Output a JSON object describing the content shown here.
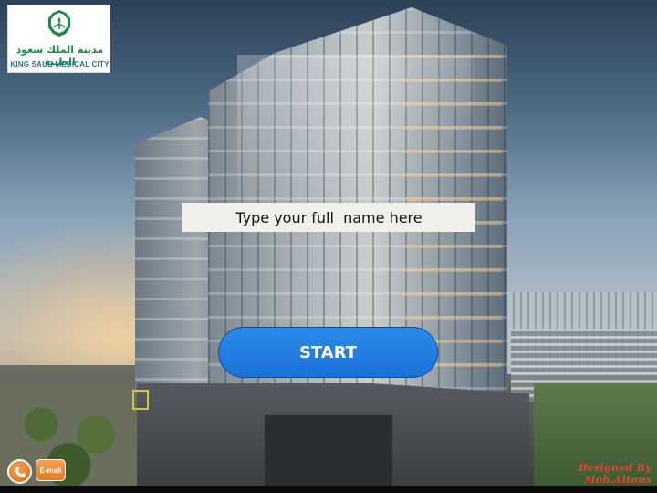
{
  "logo": {
    "arabic_text": "مدينة الملك سعود الطبية",
    "english_text": "KING SAUD MEDICAL CITY"
  },
  "form": {
    "name_placeholder": "Type your full  name here",
    "start_label": "START"
  },
  "footer": {
    "phone_icon": "phone-icon",
    "email_label": "E-mail",
    "credit": "Designed By Moh.Altous"
  },
  "colors": {
    "start_button": "#1a72d6",
    "contact_buttons": "#e27a26",
    "credit_text": "#e0492a",
    "logo_green": "#1a8a4a"
  }
}
